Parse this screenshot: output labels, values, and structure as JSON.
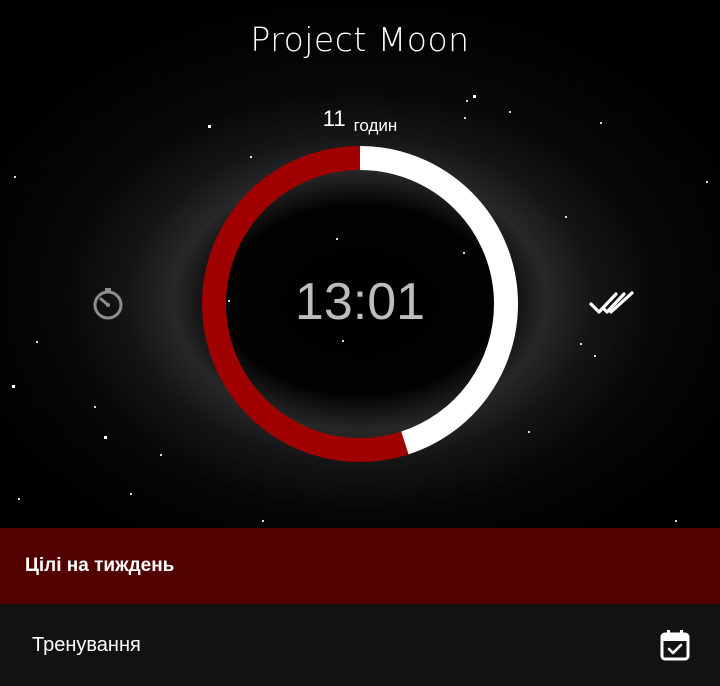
{
  "app": {
    "title": "Project Moon"
  },
  "progress": {
    "hours_value": "11",
    "hours_unit": "годин",
    "fraction_complete": 0.45,
    "completed_color": "#ffffff",
    "remaining_color": "#a00000"
  },
  "timer": {
    "display": "13:01"
  },
  "icons": {
    "left": "timer-icon",
    "right": "done-all-icon",
    "goal_action": "calendar-check-icon"
  },
  "weekly_goals": {
    "title": "Цілі на тиждень",
    "items": [
      {
        "label": "Тренування"
      }
    ]
  },
  "colors": {
    "header_background": "#520000",
    "row_background": "#121212",
    "timer_text": "#bdbdbd"
  }
}
